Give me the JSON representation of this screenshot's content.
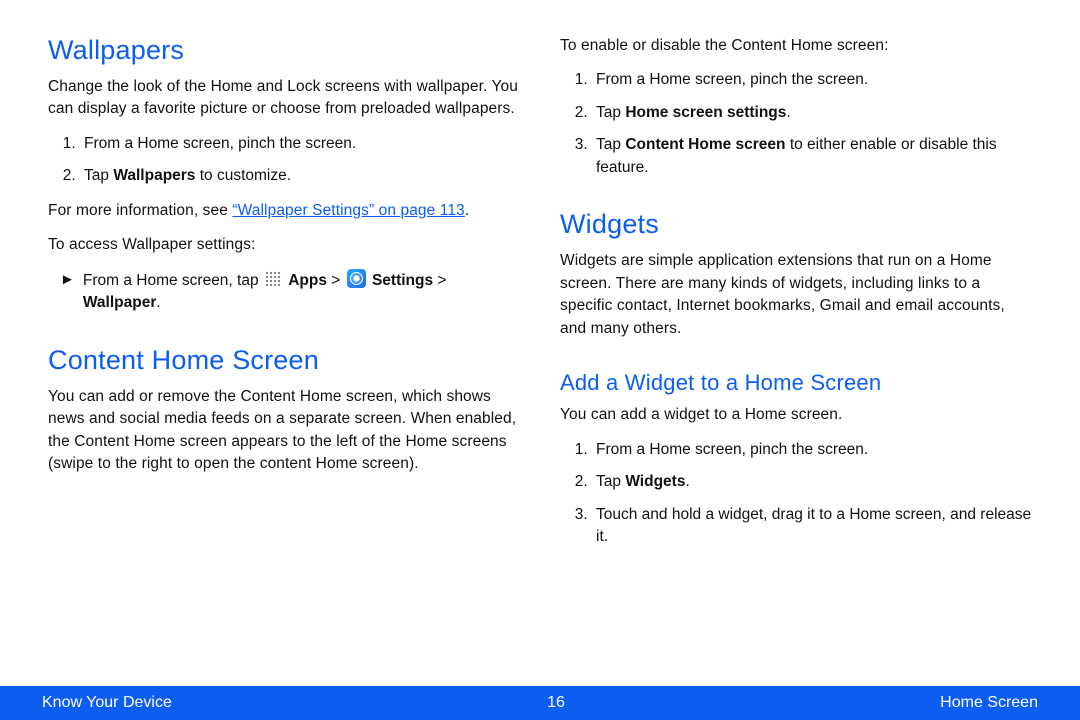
{
  "left": {
    "wallpapers": {
      "heading": "Wallpapers",
      "intro": "Change the look of the Home and Lock screens with wallpaper. You can display a favorite picture or choose from preloaded wallpapers.",
      "step1": "From a Home screen, pinch the screen.",
      "step2_pre": "Tap ",
      "step2_bold": "Wallpapers",
      "step2_post": " to customize.",
      "more_pre": "For more information, see ",
      "more_link": "“Wallpaper Settings” on page 113",
      "more_post": ".",
      "access_intro": "To access Wallpaper settings:",
      "bullet_pre": "From a Home screen, tap ",
      "bullet_apps": "Apps",
      "bullet_gt1": " > ",
      "bullet_settings": "Settings",
      "bullet_gt2": " > ",
      "bullet_wallpaper": "Wallpaper",
      "bullet_post": "."
    },
    "contentHome": {
      "heading": "Content Home Screen",
      "p": "You can add or remove the Content Home screen, which shows news and social media feeds on a separate screen. When enabled, the Content Home screen appears to the left of the Home screens (swipe to the right to open the content Home screen)."
    }
  },
  "right": {
    "enable": {
      "intro": "To enable or disable the Content Home screen:",
      "step1": "From a Home screen, pinch the screen.",
      "step2_pre": "Tap ",
      "step2_bold": "Home screen settings",
      "step2_post": ".",
      "step3_pre": "Tap ",
      "step3_bold": "Content Home screen",
      "step3_post": " to either enable or disable this feature."
    },
    "widgets": {
      "heading": "Widgets",
      "p": "Widgets are simple application extensions that run on a Home screen. There are many kinds of widgets, including links to a specific contact, Internet bookmarks, Gmail and email accounts, and many others."
    },
    "addWidget": {
      "heading": "Add a Widget to a Home Screen",
      "intro": "You can add a widget to a Home screen.",
      "step1": "From a Home screen, pinch the screen.",
      "step2_pre": "Tap ",
      "step2_bold": "Widgets",
      "step2_post": ".",
      "step3": "Touch and hold a widget, drag it to a Home screen, and release it."
    }
  },
  "footer": {
    "left": "Know Your Device",
    "page": "16",
    "right": "Home Screen"
  }
}
